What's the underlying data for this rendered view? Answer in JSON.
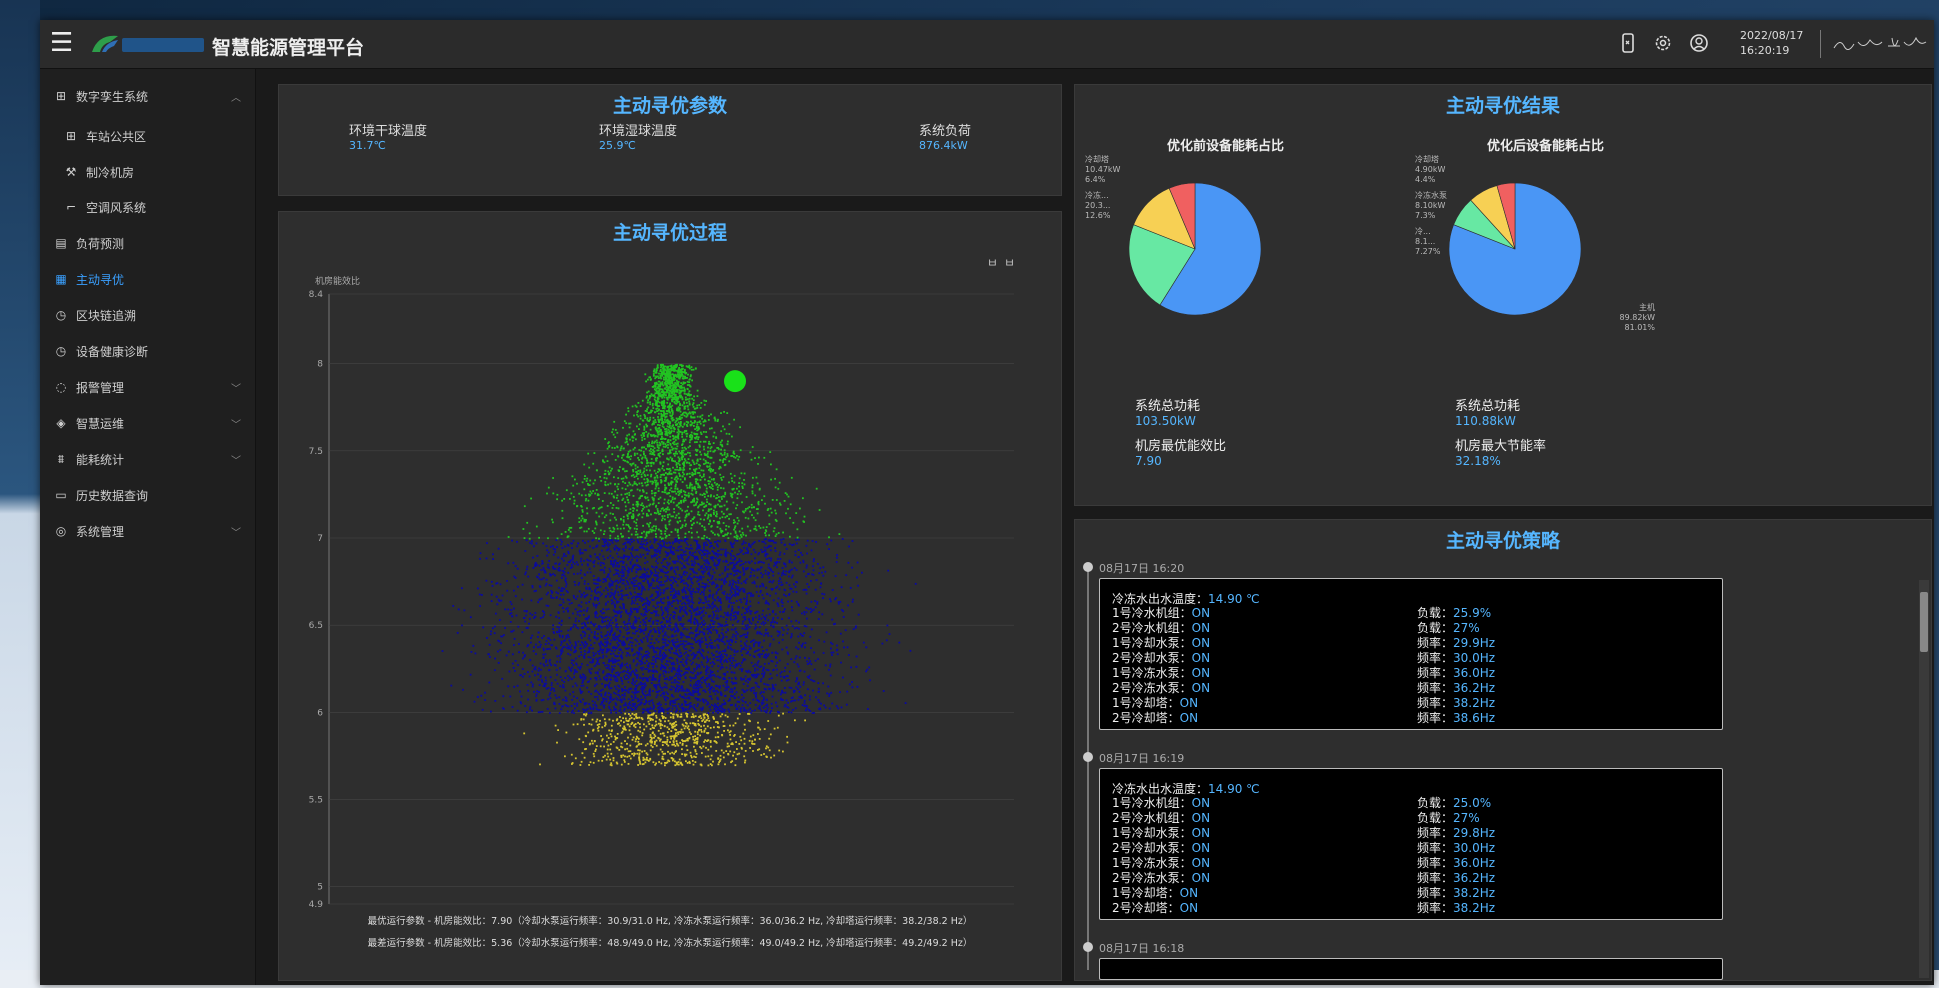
{
  "header": {
    "title": "智慧能源管理平台",
    "date": "2022/08/17",
    "time": "16:20:19",
    "icons": [
      "phone-icon",
      "gear-icon",
      "user-icon"
    ]
  },
  "sidebar": {
    "items": [
      {
        "label": "数字孪生系统",
        "icon": "grid-icon",
        "chevron": "up"
      },
      {
        "label": "车站公共区",
        "icon": "grid-icon",
        "sub": true
      },
      {
        "label": "制冷机房",
        "icon": "wrench-icon",
        "sub": true
      },
      {
        "label": "空调风系统",
        "icon": "corner-icon",
        "sub": true
      },
      {
        "label": "负荷预测",
        "icon": "doc-icon"
      },
      {
        "label": "主动寻优",
        "icon": "calculator-icon",
        "active": true
      },
      {
        "label": "区块链追溯",
        "icon": "clock-icon"
      },
      {
        "label": "设备健康诊断",
        "icon": "clock-icon"
      },
      {
        "label": "报警管理",
        "icon": "bell-icon",
        "chevron": "down"
      },
      {
        "label": "智慧运维",
        "icon": "shield-icon",
        "chevron": "down"
      },
      {
        "label": "能耗统计",
        "icon": "chart-icon",
        "chevron": "down"
      },
      {
        "label": "历史数据查询",
        "icon": "monitor-icon"
      },
      {
        "label": "系统管理",
        "icon": "settings-icon",
        "chevron": "down"
      }
    ]
  },
  "params_panel": {
    "title": "主动寻优参数",
    "params": [
      {
        "label": "环境干球温度",
        "value": "31.7℃"
      },
      {
        "label": "环境湿球温度",
        "value": "25.9℃"
      },
      {
        "label": "系统负荷",
        "value": "876.4kW"
      }
    ]
  },
  "process_panel": {
    "title": "主动寻优过程",
    "toolbar": [
      "ㅂ",
      "ㅂ"
    ],
    "footer_lines": [
      "最优运行参数 - 机房能效比：7.90（冷却水泵运行频率：30.9/31.0 Hz, 冷冻水泵运行频率：36.0/36.2 Hz, 冷却塔运行频率：38.2/38.2 Hz）",
      "最差运行参数 - 机房能效比：5.36（冷却水泵运行频率：48.9/49.0 Hz, 冷冻水泵运行频率：49.0/49.2 Hz, 冷却塔运行频率：49.2/49.2 Hz）"
    ]
  },
  "chart_data": {
    "type": "scatter",
    "title": "",
    "ylabel": "机房能效比",
    "ylim": [
      4.9,
      8.4
    ],
    "yticks": [
      "8.4",
      "8",
      "7.5",
      "7",
      "6.5",
      "6",
      "5.5",
      "5",
      "4.9"
    ],
    "grid": true,
    "bands": [
      {
        "range": [
          7.0,
          8.0
        ],
        "color": "#22c322",
        "count": 2500
      },
      {
        "range": [
          6.0,
          7.0
        ],
        "color": "#0a0aa0",
        "count": 5000
      },
      {
        "range": [
          5.7,
          6.0
        ],
        "color": "#d6c530",
        "count": 700
      }
    ],
    "optimum": {
      "value": 7.9,
      "color": "#19e119"
    }
  },
  "result_panel": {
    "title": "主动寻优结果",
    "pies": [
      {
        "title": "优化前设备能耗占比",
        "labels": [
          "冷却塔",
          "10.47kW",
          "6.4%",
          "冷冻...",
          "20.3...",
          "12.6%"
        ],
        "slices": [
          {
            "value": 58.9,
            "color": "#4a96f5"
          },
          {
            "value": 22.1,
            "color": "#67e8a3"
          },
          {
            "value": 12.6,
            "color": "#f7d054"
          },
          {
            "value": 6.4,
            "color": "#f06060"
          }
        ]
      },
      {
        "title": "优化后设备能耗占比",
        "labels": [
          "冷却塔",
          "4.90kW",
          "4.4%",
          "冷冻水泵",
          "8.10kW",
          "7.3%",
          "冷...",
          "8.1...",
          "7.27%",
          "主机",
          "89.82kW",
          "81.01%"
        ],
        "slices": [
          {
            "value": 81.01,
            "color": "#4a96f5"
          },
          {
            "value": 7.27,
            "color": "#67e8a3"
          },
          {
            "value": 7.3,
            "color": "#f7d054"
          },
          {
            "value": 4.42,
            "color": "#f06060"
          }
        ]
      }
    ],
    "stats": [
      {
        "label": "系统总功耗",
        "value": "103.50kW"
      },
      {
        "label": "系统总功耗",
        "value": "110.88kW"
      },
      {
        "label": "机房最优能效比",
        "value": "7.90"
      },
      {
        "label": "机房最大节能率",
        "value": "32.18%"
      }
    ]
  },
  "strategy_panel": {
    "title": "主动寻优策略",
    "entries": [
      {
        "date": "08月17日 16:20",
        "temp_label": "冷冻水出水温度：",
        "temp_value": "14.90 ℃",
        "rows": [
          {
            "k": "1号冷水机组：",
            "v": "ON",
            "k2": "负载：",
            "v2": "25.9%"
          },
          {
            "k": "2号冷水机组：",
            "v": "ON",
            "k2": "负载：",
            "v2": "27%"
          },
          {
            "k": "1号冷却水泵：",
            "v": "ON",
            "k2": "频率：",
            "v2": "29.9Hz"
          },
          {
            "k": "2号冷却水泵：",
            "v": "ON",
            "k2": "频率：",
            "v2": "30.0Hz"
          },
          {
            "k": "1号冷冻水泵：",
            "v": "ON",
            "k2": "频率：",
            "v2": "36.0Hz"
          },
          {
            "k": "2号冷冻水泵：",
            "v": "ON",
            "k2": "频率：",
            "v2": "36.2Hz"
          },
          {
            "k": "1号冷却塔：",
            "v": "ON",
            "k2": "频率：",
            "v2": "38.2Hz"
          },
          {
            "k": "2号冷却塔：",
            "v": "ON",
            "k2": "频率：",
            "v2": "38.6Hz"
          }
        ]
      },
      {
        "date": "08月17日 16:19",
        "temp_label": "冷冻水出水温度：",
        "temp_value": "14.90 ℃",
        "rows": [
          {
            "k": "1号冷水机组：",
            "v": "ON",
            "k2": "负载：",
            "v2": "25.0%"
          },
          {
            "k": "2号冷水机组：",
            "v": "ON",
            "k2": "负载：",
            "v2": "27%"
          },
          {
            "k": "1号冷却水泵：",
            "v": "ON",
            "k2": "频率：",
            "v2": "29.8Hz"
          },
          {
            "k": "2号冷却水泵：",
            "v": "ON",
            "k2": "频率：",
            "v2": "30.0Hz"
          },
          {
            "k": "1号冷冻水泵：",
            "v": "ON",
            "k2": "频率：",
            "v2": "36.0Hz"
          },
          {
            "k": "2号冷冻水泵：",
            "v": "ON",
            "k2": "频率：",
            "v2": "36.2Hz"
          },
          {
            "k": "1号冷却塔：",
            "v": "ON",
            "k2": "频率：",
            "v2": "38.2Hz"
          },
          {
            "k": "2号冷却塔：",
            "v": "ON",
            "k2": "频率：",
            "v2": "38.2Hz"
          }
        ]
      },
      {
        "date": "08月17日 16:18"
      }
    ]
  }
}
